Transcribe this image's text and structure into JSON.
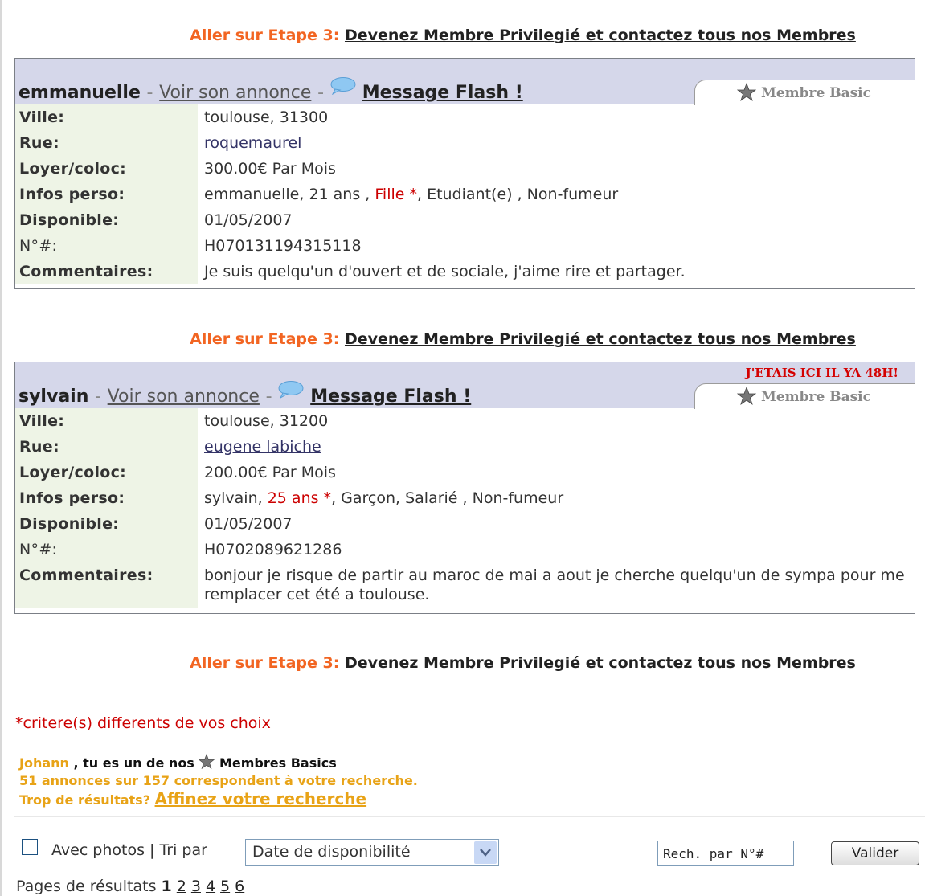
{
  "promo": {
    "lead": "Aller sur Etape 3:",
    "link": "Devenez Membre Privilegié et contactez tous nos Membres"
  },
  "listings": [
    {
      "name": "emmanuelle",
      "separator": "-",
      "view_label": "Voir son annonce",
      "flash_label": "Message Flash !",
      "badge": "Membre Basic",
      "last_seen": "",
      "rows": {
        "ville_label": "Ville:",
        "ville": "toulouse, 31300",
        "rue_label": "Rue:",
        "rue": "roquemaurel",
        "loyer_label": "Loyer/coloc:",
        "loyer": "300.00€ Par Mois",
        "infos_label": "Infos perso:",
        "infos_a": "emmanuelle, 21 ans , ",
        "infos_red": "Fille *",
        "infos_b": ", Etudiant(e) , Non-fumeur",
        "dispo_label": "Disponible:",
        "dispo": "01/05/2007",
        "num_label": "N°#:",
        "num": "H070131194315118",
        "comm_label": "Commentaires:",
        "comm": "Je suis quelqu'un d'ouvert et de sociale, j'aime rire et partager."
      }
    },
    {
      "name": "sylvain",
      "separator": "-",
      "view_label": "Voir son annonce",
      "flash_label": "Message Flash !",
      "badge": "Membre Basic",
      "last_seen": "J'ETAIS ICI IL YA 48H!",
      "rows": {
        "ville_label": "Ville:",
        "ville": "toulouse, 31200",
        "rue_label": "Rue:",
        "rue": "eugene labiche",
        "loyer_label": "Loyer/coloc:",
        "loyer": "200.00€ Par Mois",
        "infos_label": "Infos perso:",
        "infos_a": "sylvain, ",
        "infos_red": "25 ans *",
        "infos_b": ", Garçon, Salarié , Non-fumeur",
        "dispo_label": "Disponible:",
        "dispo": "01/05/2007",
        "num_label": "N°#:",
        "num": "H0702089621286",
        "comm_label": "Commentaires:",
        "comm": "bonjour je risque de partir au maroc de mai a aout je cherche quelqu'un de sympa pour me remplacer cet été a toulouse."
      }
    }
  ],
  "note": "*critere(s) differents de vos choix",
  "member": {
    "user": "Johann",
    "text": " , tu es un de nos ",
    "level": "Membres Basics",
    "count_text": "51 annonces sur 157 correspondent à votre recherche.",
    "too_many": "Trop de résultats? ",
    "refine": "Affinez votre recherche"
  },
  "controls": {
    "checkbox_label": "Avec photos | Tri par",
    "sort_value": "Date de disponibilité",
    "search_value": "Rech. par N°#",
    "submit": "Valider"
  },
  "pagination": {
    "label": "Pages de résultats",
    "current": "1",
    "pages": [
      "2",
      "3",
      "4",
      "5",
      "6"
    ]
  },
  "colors": {
    "accent_orange": "#f26522",
    "header_bg": "#d5d7ea",
    "label_bg": "#eef4e6",
    "price": "#d36b4a",
    "warning_red": "#cc0000",
    "member_gold": "#e8a317"
  },
  "icons": [
    "speech-bubble-icon",
    "star-icon",
    "chevron-down-icon"
  ]
}
